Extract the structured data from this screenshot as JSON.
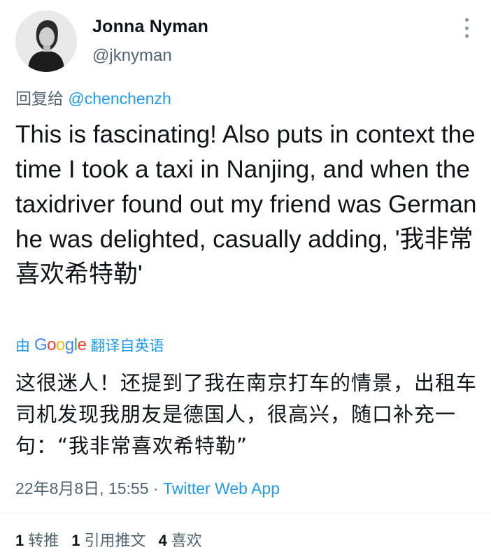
{
  "author": {
    "name": "Jonna Nyman",
    "handle": "@jknyman",
    "avatar_icon": "profile-photo"
  },
  "reply": {
    "prefix": "回复给 ",
    "mention": "@chenchenzh"
  },
  "tweet": {
    "text": "This is fascinating! Also puts in context the time I took a taxi in Nanjing, and when the taxidriver found out my friend was German he was delighted, casually adding, '我非常喜欢希特勒'"
  },
  "translation": {
    "by_label": "由",
    "google": [
      "G",
      "o",
      "o",
      "g",
      "l",
      "e"
    ],
    "label": "翻译自英语",
    "text": "这很迷人！还提到了我在南京打车的情景，出租车司机发现我朋友是德国人，很高兴，随口补充一句：“我非常喜欢希特勒”"
  },
  "meta": {
    "timestamp": "22年8月8日, 15:55",
    "separator": " · ",
    "source": "Twitter Web App"
  },
  "stats": {
    "retweets_count": "1",
    "retweets_label": "转推",
    "quotes_count": "1",
    "quotes_label": "引用推文",
    "likes_count": "4",
    "likes_label": "喜欢"
  },
  "colors": {
    "link": "#1d9bf0",
    "secondary_text": "#536471",
    "primary_text": "#0f1419"
  }
}
